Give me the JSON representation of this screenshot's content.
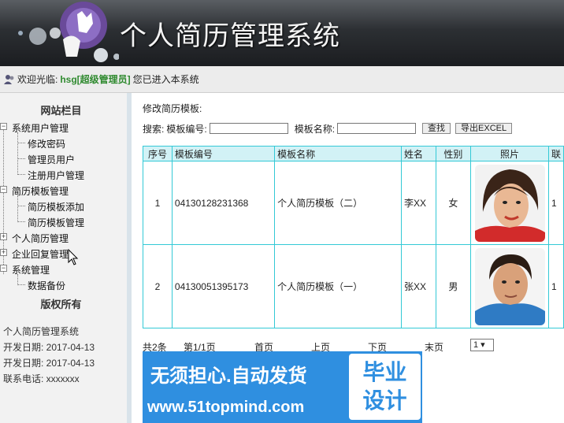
{
  "header": {
    "title": "个人简历管理系统"
  },
  "welcome": {
    "prefix": "欢迎光临:",
    "user": "hsg[超级管理员]",
    "suffix": "您已进入本系统"
  },
  "sidebar": {
    "column_title": "网站栏目",
    "groups": [
      {
        "label": "系统用户管理",
        "children": [
          "修改密码",
          "管理员用户",
          "注册用户管理"
        ]
      },
      {
        "label": "简历模板管理",
        "children": [
          "简历模板添加",
          "简历模板管理"
        ]
      },
      {
        "label": "个人简历管理",
        "children": []
      },
      {
        "label": "企业回复管理",
        "children": []
      },
      {
        "label": "系统管理",
        "children": [
          "数据备份"
        ]
      }
    ],
    "copyright_title": "版权所有",
    "info": [
      "个人简历管理系统",
      "开发日期:  2017-04-13",
      "开发日期:  2017-04-13",
      "联系电话:  xxxxxxx"
    ]
  },
  "main": {
    "subtitle": "修改简历模板:",
    "search": {
      "label": "搜索:",
      "code_label": "模板编号:",
      "name_label": "模板名称:",
      "code_value": "",
      "name_value": "",
      "search_button": "查找",
      "export_button": "导出EXCEL"
    },
    "table": {
      "headers": [
        "序号",
        "模板编号",
        "模板名称",
        "姓名",
        "性别",
        "照片",
        "联"
      ],
      "rows": [
        {
          "index": "1",
          "code": "04130128231368",
          "name": "个人简历模板（二）",
          "person": "李XX",
          "gender": "女",
          "last": "1"
        },
        {
          "index": "2",
          "code": "04130051395173",
          "name": "个人简历模板（一）",
          "person": "张XX",
          "gender": "男",
          "last": "1"
        }
      ]
    },
    "pager": {
      "total": "共2条",
      "page": "第1/1页",
      "first": "首页",
      "prev": "上页",
      "next": "下页",
      "last": "末页",
      "select_value": "1 ▾"
    }
  },
  "banner": {
    "line1": "无须担心.自动发货",
    "line2": "www.51topmind.com",
    "stamp1": "毕业",
    "stamp2": "设计"
  },
  "colors": {
    "table_border": "#33c9d6",
    "table_header": "#d2f2f6",
    "banner_blue": "#2f8fe0",
    "username_green": "#2f8a2f"
  }
}
